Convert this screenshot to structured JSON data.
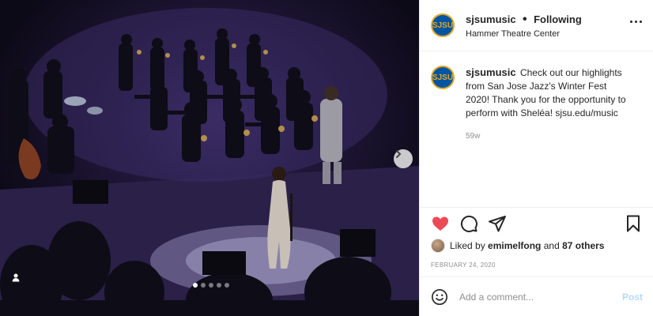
{
  "post": {
    "username": "sjsumusic",
    "following_label": "Following",
    "location": "Hammer Theatre Center",
    "avatar_text": "SJSU",
    "caption": "Check out our highlights from San Jose Jazz's Winter Fest 2020! Thank you for the opportunity to perform with Sheléa! sjsu.edu/music",
    "age": "59w",
    "liked_by_prefix": "Liked by",
    "liked_by_user": "emimelfong",
    "liked_by_and": "and",
    "liked_by_others": "87 others",
    "date": "FEBRUARY 24, 2020",
    "carousel": {
      "count": 5,
      "active_index": 0
    }
  },
  "comment": {
    "placeholder": "Add a comment...",
    "post_label": "Post"
  },
  "colors": {
    "heart": "#ed4956",
    "post_disabled": "#b3dbff",
    "avatar_bg": "#0055a2",
    "avatar_fg": "#e5a823"
  },
  "icons": {
    "like": "heart-icon",
    "comment": "comment-icon",
    "share": "share-icon",
    "save": "bookmark-icon",
    "emoji": "emoji-icon",
    "more": "more-icon",
    "next": "chevron-right-icon",
    "tag": "user-tag-icon"
  }
}
